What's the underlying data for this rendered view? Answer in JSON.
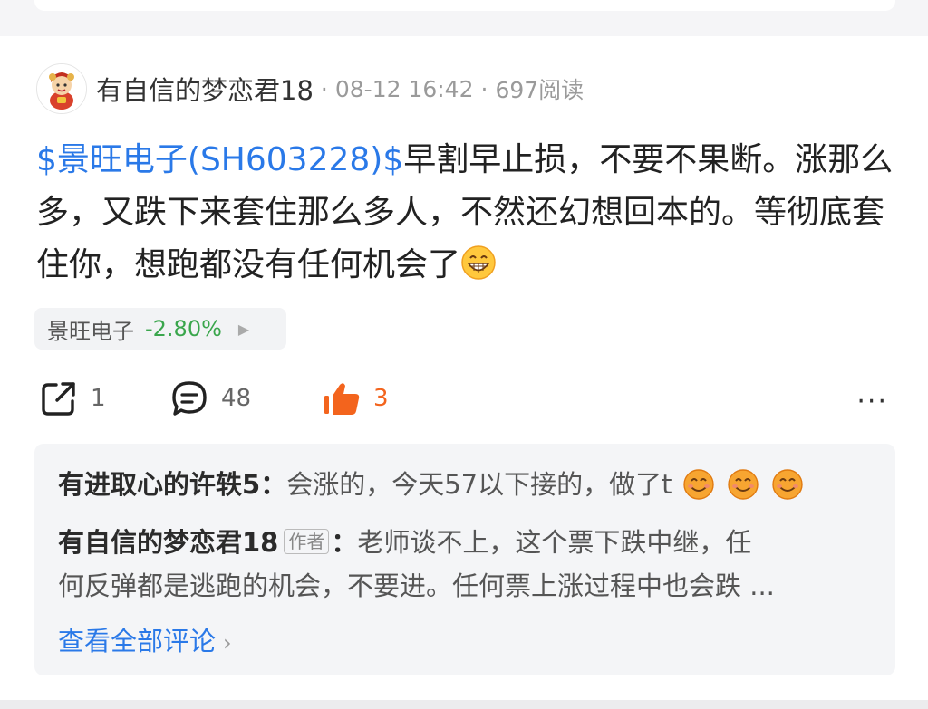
{
  "post": {
    "author": "有自信的梦恋君18",
    "time": "08-12 16:42",
    "views": "697阅读",
    "stock_link": "$景旺电子(SH603228)$",
    "text_after_link": "早割早止损，不要不果断。涨那么多，又跌下来套住那么多人，不然还幻想回本的。等彻底套住你，想跑都没有任何机会了",
    "inline_emoji": "grinning-face-emoji"
  },
  "stock_tag": {
    "name": "景旺电子",
    "change": "-2.80%",
    "change_color": "#3aa64c"
  },
  "actions": {
    "share_count": "1",
    "comment_count": "48",
    "like_count": "3",
    "more_label": "···",
    "like_color": "#f3641d"
  },
  "comments": {
    "items": [
      {
        "user": "有进取心的许轶5",
        "sep": "：",
        "text": "会涨的，今天57以下接的，做了t",
        "emoji_count": 3
      },
      {
        "user": "有自信的梦恋君18",
        "badge": "作者",
        "sep": "：",
        "text_line1": "老师谈不上，这个票下跌中继，任",
        "text_line2": "何反弹都是逃跑的机会，不要进。任何票上涨过程中也会跌 ..."
      }
    ],
    "see_all": "查看全部评论"
  },
  "colors": {
    "link": "#2a79e8",
    "panel_bg": "#f4f5f7"
  }
}
